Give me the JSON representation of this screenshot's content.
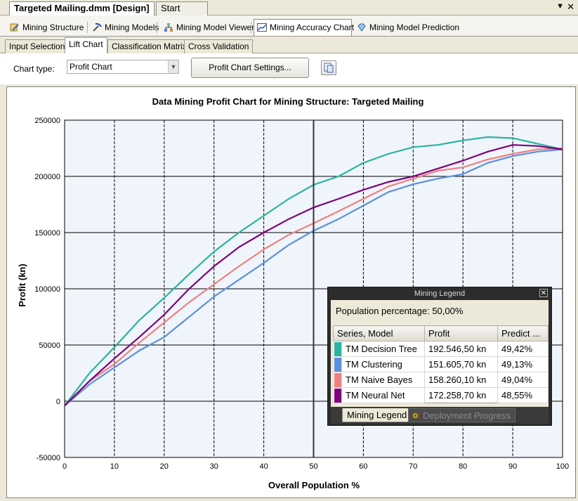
{
  "document_tabs": {
    "active": "Targeted Mailing.dmm [Design]",
    "inactive": "Start Page",
    "menu_icon": "chevron-down-icon",
    "close_icon": "close-icon"
  },
  "designer_tabs": [
    {
      "label": "Mining Structure",
      "icon": "mining-structure-icon"
    },
    {
      "label": "Mining Models",
      "icon": "pickaxe-icon"
    },
    {
      "label": "Mining Model Viewer",
      "icon": "model-viewer-icon"
    },
    {
      "label": "Mining Accuracy Chart",
      "icon": "accuracy-chart-icon",
      "active": true
    },
    {
      "label": "Mining Model Prediction",
      "icon": "diamond-icon"
    }
  ],
  "sub_tabs": [
    {
      "label": "Input Selection"
    },
    {
      "label": "Lift Chart",
      "active": true
    },
    {
      "label": "Classification Matrix"
    },
    {
      "label": "Cross Validation"
    }
  ],
  "toolbar": {
    "chart_type_label": "Chart type:",
    "chart_type_value": "Profit Chart",
    "settings_button": "Profit Chart Settings...",
    "copy_icon": "copy-icon"
  },
  "chart_data": {
    "type": "line",
    "title": "Data Mining Profit Chart for Mining Structure: Targeted Mailing",
    "xlabel": "Overall Population %",
    "ylabel": "Profit (kn)",
    "xlim": [
      0,
      100
    ],
    "ylim": [
      -50000,
      250000
    ],
    "x_ticks": [
      0,
      10,
      20,
      30,
      40,
      50,
      60,
      70,
      80,
      90,
      100
    ],
    "y_ticks": [
      -50000,
      0,
      50000,
      100000,
      150000,
      200000,
      250000
    ],
    "x_tick_labels": [
      "0",
      "10",
      "20",
      "30",
      "40",
      "50",
      "60",
      "70",
      "80",
      "90",
      "100"
    ],
    "y_tick_labels": [
      "-50000",
      "0",
      "50000",
      "100000",
      "150000",
      "200000",
      "250000"
    ],
    "grid": true,
    "marker_x": 50,
    "x": [
      0,
      5,
      10,
      15,
      20,
      25,
      30,
      35,
      40,
      45,
      50,
      55,
      60,
      65,
      70,
      75,
      80,
      85,
      90,
      95,
      100
    ],
    "series": [
      {
        "name": "TM Decision Tree",
        "color": "#2ab3a0",
        "values": [
          -4000,
          25000,
          48000,
          72000,
          92000,
          113000,
          133000,
          150000,
          165000,
          180000,
          192500,
          200000,
          212000,
          220000,
          226000,
          228000,
          232000,
          235000,
          234000,
          229000,
          224000
        ]
      },
      {
        "name": "TM Clustering",
        "color": "#5b8fe0",
        "values": [
          -4000,
          15000,
          30000,
          45000,
          57000,
          75000,
          93000,
          108000,
          123000,
          139000,
          151600,
          162000,
          174000,
          186000,
          193000,
          198000,
          202000,
          212000,
          218000,
          222000,
          224000
        ]
      },
      {
        "name": "TM Naive Bayes",
        "color": "#ee8080",
        "values": [
          -4000,
          18000,
          33000,
          52000,
          70000,
          88000,
          104000,
          120000,
          135000,
          148000,
          158300,
          169000,
          180000,
          191000,
          198000,
          205000,
          208000,
          215000,
          220000,
          224000,
          225000
        ]
      },
      {
        "name": "TM Neural Net",
        "color": "#7d007d",
        "values": [
          -4000,
          18000,
          38000,
          57000,
          77000,
          100000,
          120000,
          137000,
          150000,
          162000,
          172300,
          180000,
          188000,
          195000,
          200000,
          207000,
          214000,
          222000,
          228000,
          227000,
          224000
        ]
      }
    ]
  },
  "legend": {
    "title": "Mining Legend",
    "close_icon": "close-icon",
    "population_text": "Population percentage: 50,00%",
    "columns": [
      "Series, Model",
      "Profit",
      "Predict ..."
    ],
    "rows": [
      {
        "model": "TM Decision Tree",
        "profit": "192.546,50 kn",
        "predict": "49,42%",
        "color": "#2ab3a0"
      },
      {
        "model": "TM Clustering",
        "profit": "151.605,70 kn",
        "predict": "49,13%",
        "color": "#5b8fe0"
      },
      {
        "model": "TM Naive Bayes",
        "profit": "158.260,10 kn",
        "predict": "49,04%",
        "color": "#ee8080"
      },
      {
        "model": "TM Neural Net",
        "profit": "172.258,70 kn",
        "predict": "48,55%",
        "color": "#7d007d"
      }
    ],
    "tabs": [
      {
        "label": "Mining Legend",
        "active": true
      },
      {
        "label": "Deployment Progress",
        "icon": "gear-icon"
      }
    ]
  }
}
